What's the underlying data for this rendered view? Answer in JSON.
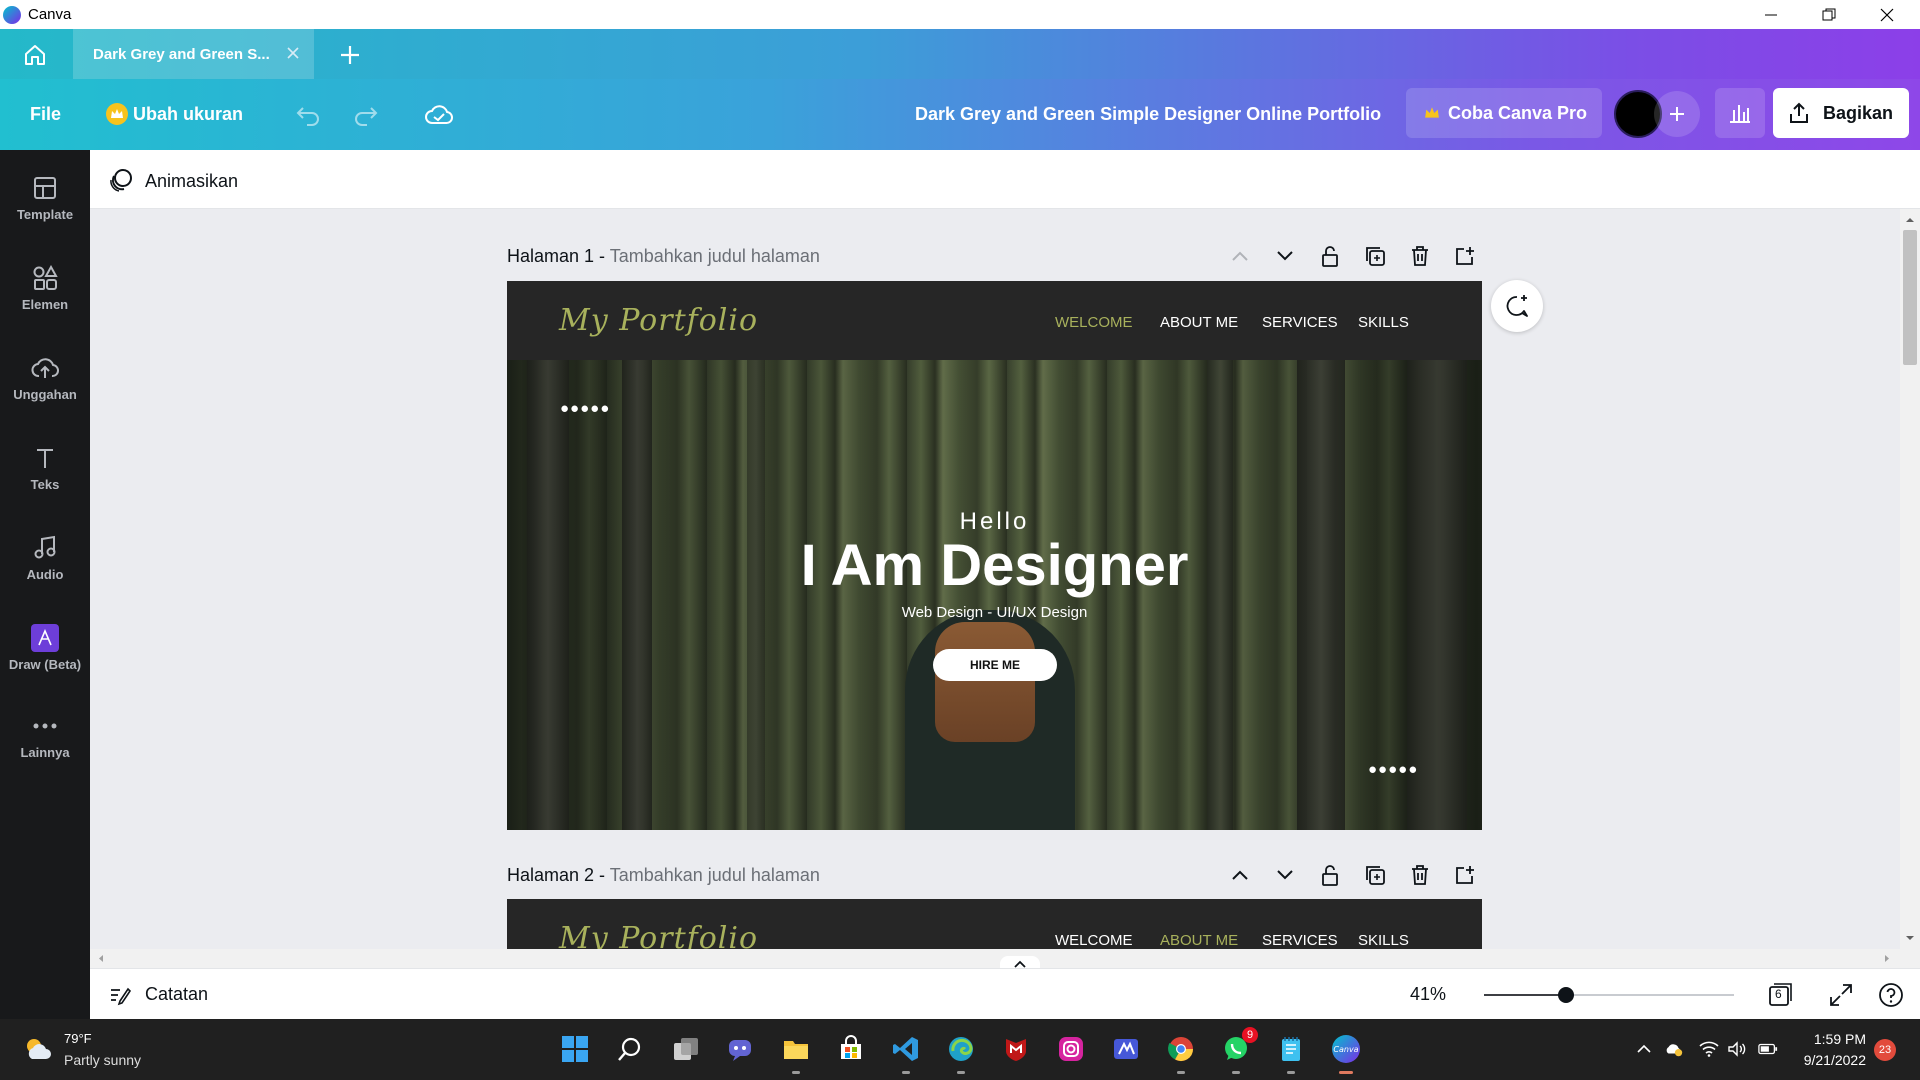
{
  "window": {
    "app_name": "Canva"
  },
  "tabs": {
    "active_label": "Dark Grey and Green S..."
  },
  "toolbar": {
    "file_label": "File",
    "resize_label": "Ubah ukuran",
    "doc_title": "Dark Grey and Green Simple Designer Online Portfolio",
    "pro_label": "Coba Canva Pro",
    "share_label": "Bagikan"
  },
  "sidebar": {
    "items": [
      {
        "label": "Template",
        "icon": "template-icon"
      },
      {
        "label": "Elemen",
        "icon": "elements-icon"
      },
      {
        "label": "Unggahan",
        "icon": "upload-icon"
      },
      {
        "label": "Teks",
        "icon": "text-icon"
      },
      {
        "label": "Audio",
        "icon": "audio-icon"
      },
      {
        "label": "Draw (Beta)",
        "icon": "draw-icon"
      },
      {
        "label": "Lainnya",
        "icon": "more-icon"
      }
    ]
  },
  "animate": {
    "label": "Animasikan"
  },
  "pages": [
    {
      "number_label": "Halaman 1 -",
      "title_placeholder": "Tambahkan judul halaman",
      "logo": "My Portfolio",
      "nav": [
        "WELCOME",
        "ABOUT ME",
        "SERVICES",
        "SKILLS"
      ],
      "active_nav": "WELCOME",
      "hero": {
        "dots": "●●●●●",
        "hello": "Hello",
        "headline": "I Am Designer",
        "subline": "Web Design - UI/UX Design",
        "button": "HIRE ME"
      }
    },
    {
      "number_label": "Halaman 2 -",
      "title_placeholder": "Tambahkan judul halaman",
      "logo": "My Portfolio",
      "nav": [
        "WELCOME",
        "ABOUT ME",
        "SERVICES",
        "SKILLS"
      ],
      "active_nav": "ABOUT ME"
    }
  ],
  "bottom": {
    "notes_label": "Catatan",
    "zoom_label": "41%",
    "zoom_value": 0.41,
    "page_count": "6"
  },
  "taskbar": {
    "temperature": "79°F",
    "condition": "Partly sunny",
    "time": "1:59 PM",
    "date": "9/21/2022",
    "notification_count": "23",
    "whatsapp_badge": "9"
  },
  "colors": {
    "accent_green": "#a8b15c",
    "slide_bg": "#262626",
    "gradient_start": "#21bfd0",
    "gradient_end": "#8e47e8"
  }
}
